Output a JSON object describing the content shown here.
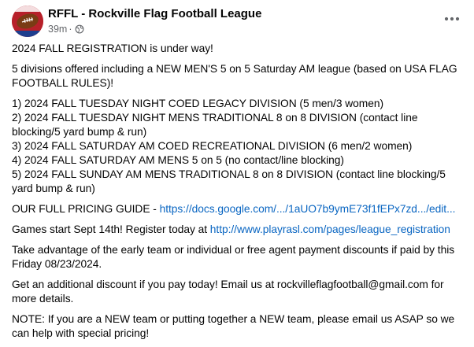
{
  "post": {
    "author": "RFFL - Rockville Flag Football League",
    "time": "39m",
    "separator": "·",
    "privacy_icon": "globe-icon",
    "more_icon": "more-options-icon",
    "paragraphs": {
      "p1": "2024 FALL REGISTRATION is under way!",
      "p2": "5 divisions offered including a NEW MEN'S 5 on 5 Saturday AM league (based on USA FLAG FOOTBALL RULES)!",
      "divisions": [
        "1) 2024 FALL TUESDAY NIGHT COED LEGACY DIVISION (5 men/3 women)",
        "2) 2024 FALL TUESDAY NIGHT MENS TRADITIONAL 8 on 8 DIVISION (contact line blocking/5 yard bump & run)",
        "3) 2024 FALL SATURDAY AM COED RECREATIONAL DIVISION (6 men/2 women)",
        "4) 2024 FALL SATURDAY AM MENS 5 on 5 (no contact/line blocking)",
        "5) 2024 FALL SUNDAY AM MENS TRADITIONAL 8 on 8 DIVISION (contact line blocking/5 yard bump & run)"
      ],
      "pricing_prefix": "OUR FULL PRICING GUIDE - ",
      "pricing_link": "https://docs.google.com/.../1aUO7b9ymE73f1fEPx7zd.../edit...",
      "games_prefix": "Games start Sept 14th! Register today at ",
      "games_link": "http://www.playrasl.com/pages/league_registration",
      "p_discount": "Take advantage of the early team or individual or free agent payment discounts if paid by this Friday 08/23/2024.",
      "p_email": "Get an additional discount if you pay today! Email us at rockvilleflagfootball@gmail.com for more details.",
      "p_note": "NOTE: If you are a NEW team or putting together a NEW team, please email us ASAP so we can help with special pricing!"
    }
  },
  "colors": {
    "text": "#050505",
    "secondary": "#65676b",
    "link": "#0a66c2",
    "avatar_red": "#b7202a",
    "football_brown": "#7a3b14"
  }
}
